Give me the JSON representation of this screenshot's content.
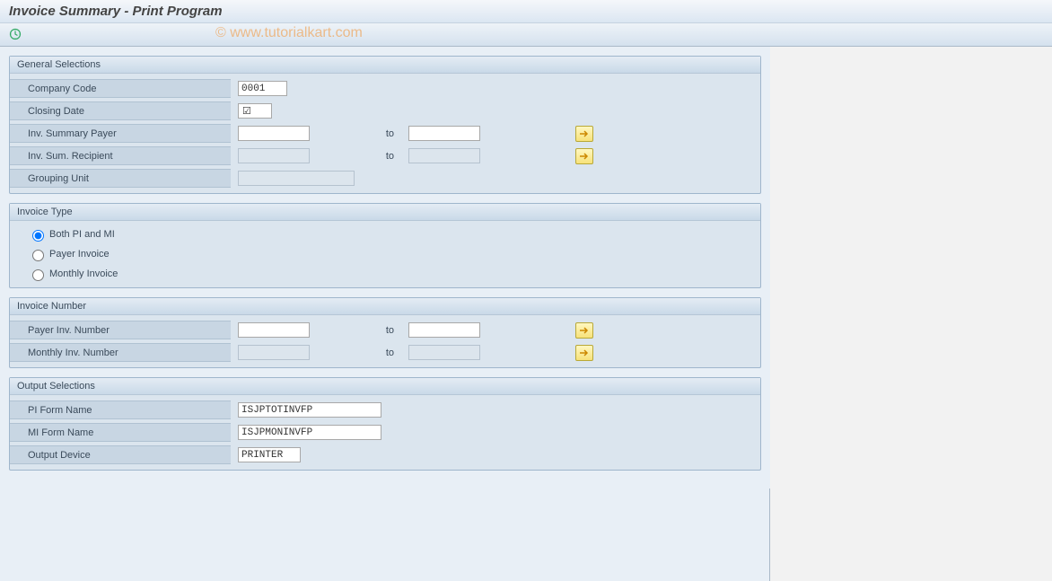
{
  "header": {
    "title": "Invoice Summary - Print Program"
  },
  "watermark": "© www.tutorialkart.com",
  "groups": {
    "general": {
      "title": "General Selections",
      "company_code": {
        "label": "Company Code",
        "value": "0001"
      },
      "closing_date": {
        "label": "Closing Date",
        "checked": true
      },
      "payer": {
        "label": "Inv. Summary Payer",
        "from": "",
        "to_label": "to",
        "to": ""
      },
      "recipient": {
        "label": "Inv. Sum. Recipient",
        "from": "",
        "to_label": "to",
        "to": ""
      },
      "grouping_unit": {
        "label": "Grouping Unit",
        "value": ""
      }
    },
    "invoice_type": {
      "title": "Invoice Type",
      "options": {
        "both": "Both PI and MI",
        "payer": "Payer Invoice",
        "monthly": "Monthly Invoice"
      },
      "selected": "both"
    },
    "invoice_number": {
      "title": "Invoice Number",
      "payer_inv": {
        "label": "Payer Inv. Number",
        "from": "",
        "to_label": "to",
        "to": ""
      },
      "monthly_inv": {
        "label": "Monthly Inv. Number",
        "from": "",
        "to_label": "to",
        "to": ""
      }
    },
    "output": {
      "title": "Output Selections",
      "pi_form": {
        "label": "PI Form Name",
        "value": "ISJPTOTINVFP"
      },
      "mi_form": {
        "label": "MI Form Name",
        "value": "ISJPMONINVFP"
      },
      "device": {
        "label": "Output Device",
        "value": "PRINTER"
      }
    }
  },
  "icons": {
    "arrow": "⇨"
  }
}
